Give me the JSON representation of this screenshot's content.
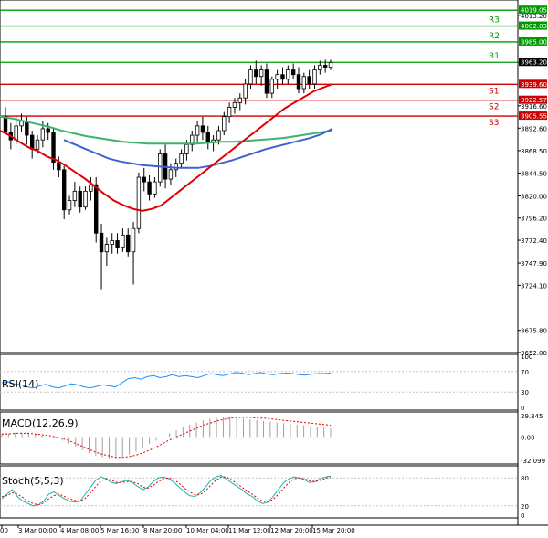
{
  "chart_data": {
    "type": "candlestick",
    "main": {
      "ylim": [
        3652.0,
        4030.0
      ],
      "price_ticks": [
        "4013.20",
        "3963.20",
        "3916.60",
        "3892.60",
        "3868.50",
        "3844.50",
        "3820.00",
        "3796.20",
        "3772.40",
        "3747.90",
        "3724.10",
        "3675.80",
        "3652.00"
      ],
      "last_price": "3963.20",
      "levels": [
        {
          "name": "R3",
          "value": 4002.03,
          "label": "4002.03",
          "color": "#009900"
        },
        {
          "name": "R2",
          "value": 3985.0,
          "label": "3985.00",
          "color": "#009900"
        },
        {
          "name": "R1",
          "value": 3963.2,
          "label": "",
          "color": "#009900"
        },
        {
          "name": "S1",
          "value": 3939.6,
          "label": "3939.60",
          "color": "#cc0000"
        },
        {
          "name": "S2",
          "value": 3922.57,
          "label": "3922.57",
          "color": "#cc0000"
        },
        {
          "name": "S3",
          "value": 3905.55,
          "label": "3905.55",
          "color": "#cc0000"
        }
      ],
      "top_line": {
        "value": 4019.05,
        "label": "4019.05",
        "color": "#009900"
      },
      "candles": [
        [
          3905,
          3915,
          3895,
          3888
        ],
        [
          3888,
          3898,
          3870,
          3880
        ],
        [
          3880,
          3905,
          3875,
          3895
        ],
        [
          3895,
          3908,
          3888,
          3900
        ],
        [
          3900,
          3905,
          3875,
          3885
        ],
        [
          3885,
          3890,
          3860,
          3870
        ],
        [
          3870,
          3885,
          3865,
          3880
        ],
        [
          3880,
          3900,
          3872,
          3892
        ],
        [
          3892,
          3898,
          3880,
          3888
        ],
        [
          3888,
          3892,
          3848,
          3856
        ],
        [
          3856,
          3862,
          3840,
          3848
        ],
        [
          3848,
          3852,
          3795,
          3805
        ],
        [
          3805,
          3820,
          3800,
          3815
        ],
        [
          3815,
          3835,
          3808,
          3825
        ],
        [
          3825,
          3830,
          3802,
          3808
        ],
        [
          3808,
          3830,
          3805,
          3825
        ],
        [
          3825,
          3840,
          3815,
          3832
        ],
        [
          3832,
          3840,
          3770,
          3780
        ],
        [
          3780,
          3790,
          3720,
          3760
        ],
        [
          3760,
          3775,
          3745,
          3768
        ],
        [
          3768,
          3780,
          3758,
          3772
        ],
        [
          3772,
          3780,
          3758,
          3765
        ],
        [
          3765,
          3785,
          3760,
          3778
        ],
        [
          3778,
          3785,
          3755,
          3760
        ],
        [
          3760,
          3792,
          3725,
          3785
        ],
        [
          3785,
          3845,
          3780,
          3840
        ],
        [
          3840,
          3850,
          3825,
          3835
        ],
        [
          3835,
          3842,
          3815,
          3822
        ],
        [
          3822,
          3840,
          3818,
          3835
        ],
        [
          3835,
          3870,
          3830,
          3865
        ],
        [
          3865,
          3875,
          3828,
          3838
        ],
        [
          3838,
          3855,
          3832,
          3848
        ],
        [
          3848,
          3860,
          3840,
          3855
        ],
        [
          3855,
          3870,
          3850,
          3865
        ],
        [
          3865,
          3880,
          3858,
          3875
        ],
        [
          3875,
          3890,
          3868,
          3885
        ],
        [
          3885,
          3900,
          3878,
          3895
        ],
        [
          3895,
          3905,
          3880,
          3888
        ],
        [
          3888,
          3895,
          3870,
          3878
        ],
        [
          3878,
          3885,
          3868,
          3880
        ],
        [
          3880,
          3895,
          3875,
          3890
        ],
        [
          3890,
          3910,
          3885,
          3905
        ],
        [
          3905,
          3920,
          3898,
          3915
        ],
        [
          3915,
          3925,
          3908,
          3920
        ],
        [
          3920,
          3930,
          3912,
          3925
        ],
        [
          3925,
          3945,
          3918,
          3940
        ],
        [
          3940,
          3960,
          3935,
          3955
        ],
        [
          3955,
          3965,
          3940,
          3948
        ],
        [
          3948,
          3960,
          3938,
          3955
        ],
        [
          3955,
          3962,
          3925,
          3930
        ],
        [
          3930,
          3948,
          3925,
          3945
        ],
        [
          3945,
          3955,
          3935,
          3950
        ],
        [
          3950,
          3958,
          3940,
          3945
        ],
        [
          3945,
          3960,
          3940,
          3955
        ],
        [
          3955,
          3962,
          3945,
          3950
        ],
        [
          3950,
          3958,
          3930,
          3935
        ],
        [
          3935,
          3952,
          3930,
          3948
        ],
        [
          3948,
          3955,
          3935,
          3940
        ],
        [
          3940,
          3960,
          3935,
          3955
        ],
        [
          3955,
          3965,
          3950,
          3960
        ],
        [
          3960,
          3966,
          3952,
          3958
        ],
        [
          3958,
          3966,
          3955,
          3963
        ]
      ],
      "ma_red": [
        3890,
        3885,
        3878,
        3872,
        3868,
        3862,
        3858,
        3852,
        3845,
        3838,
        3830,
        3822,
        3815,
        3810,
        3806,
        3804,
        3806,
        3810,
        3818,
        3826,
        3834,
        3842,
        3850,
        3858,
        3866,
        3874,
        3882,
        3890,
        3898,
        3906,
        3914,
        3920,
        3926,
        3932,
        3936,
        3940
      ],
      "ma_green": [
        3905,
        3903,
        3900,
        3897,
        3894,
        3890,
        3887,
        3884,
        3882,
        3880,
        3878,
        3877,
        3876,
        3876,
        3876,
        3876,
        3876,
        3877,
        3878,
        3878,
        3879,
        3880,
        3881,
        3882,
        3884,
        3886,
        3888,
        3890
      ],
      "ma_blue": [
        3880,
        3875,
        3870,
        3865,
        3860,
        3857,
        3855,
        3853,
        3852,
        3851,
        3850,
        3850,
        3850,
        3852,
        3855,
        3858,
        3862,
        3866,
        3870,
        3873,
        3876,
        3879,
        3882,
        3886,
        3892
      ]
    },
    "rsi": {
      "label": "RSI(14)",
      "ticks": [
        "100",
        "70",
        "30",
        "0"
      ],
      "values": [
        48,
        50,
        46,
        44,
        40,
        38,
        42,
        45,
        40,
        38,
        42,
        46,
        44,
        40,
        38,
        41,
        44,
        42,
        40,
        48,
        56,
        58,
        55,
        60,
        62,
        58,
        60,
        64,
        60,
        62,
        60,
        58,
        62,
        66,
        64,
        62,
        65,
        68,
        67,
        64,
        66,
        68,
        65,
        64,
        66,
        67,
        66,
        64,
        63,
        65,
        66,
        66,
        67
      ]
    },
    "macd": {
      "label": "MACD(12,26,9)",
      "ticks": [
        "29.345",
        "0.00",
        "-32.099"
      ],
      "hist": [
        4,
        5,
        6,
        6,
        5,
        4,
        2,
        0,
        -2,
        -5,
        -9,
        -13,
        -18,
        -22,
        -26,
        -28,
        -30,
        -29,
        -27,
        -24,
        -20,
        -15,
        -10,
        -5,
        0,
        5,
        9,
        13,
        17,
        20,
        23,
        25,
        26,
        27,
        27,
        26,
        25,
        24,
        23,
        22,
        21,
        20,
        19,
        18,
        17,
        16,
        15,
        14,
        13,
        12
      ],
      "signal": [
        4,
        4,
        5,
        5,
        5,
        4,
        3,
        2,
        0,
        -2,
        -5,
        -9,
        -13,
        -17,
        -21,
        -24,
        -26,
        -28,
        -28,
        -27,
        -25,
        -22,
        -18,
        -14,
        -9,
        -4,
        0,
        4,
        8,
        12,
        16,
        19,
        22,
        24,
        26,
        27,
        27,
        27,
        26,
        26,
        25,
        24,
        23,
        22,
        21,
        20,
        19,
        18,
        17,
        16
      ]
    },
    "stoch": {
      "label": "Stoch(5,5,3)",
      "ticks": [
        "80",
        "20",
        "0"
      ],
      "k": [
        35,
        45,
        55,
        40,
        30,
        25,
        20,
        22,
        30,
        45,
        50,
        42,
        35,
        30,
        28,
        30,
        45,
        60,
        75,
        82,
        78,
        70,
        68,
        72,
        75,
        70,
        62,
        55,
        60,
        72,
        80,
        82,
        78,
        70,
        60,
        50,
        42,
        40,
        48,
        60,
        74,
        82,
        85,
        78,
        70,
        62,
        55,
        45,
        40,
        30,
        25,
        28,
        40,
        55,
        70,
        78,
        82,
        80,
        76,
        70,
        72,
        78,
        82,
        84
      ],
      "d": [
        40,
        42,
        48,
        45,
        38,
        30,
        25,
        22,
        26,
        35,
        42,
        45,
        40,
        35,
        32,
        30,
        36,
        48,
        62,
        74,
        78,
        75,
        70,
        70,
        72,
        72,
        68,
        60,
        58,
        64,
        72,
        78,
        80,
        76,
        68,
        58,
        50,
        44,
        44,
        52,
        64,
        75,
        82,
        82,
        76,
        68,
        60,
        52,
        45,
        36,
        30,
        28,
        34,
        45,
        58,
        70,
        78,
        80,
        78,
        74,
        72,
        75,
        79,
        82
      ]
    },
    "x_ticks": [
      "00",
      "3 Mar 00:00",
      "4 Mar 08:00",
      "5 Mar 16:00",
      "8 Mar 20:00",
      "10 Mar 04:00",
      "11 Mar 12:00",
      "12 Mar 20:00",
      "15 Mar 20:00"
    ]
  }
}
